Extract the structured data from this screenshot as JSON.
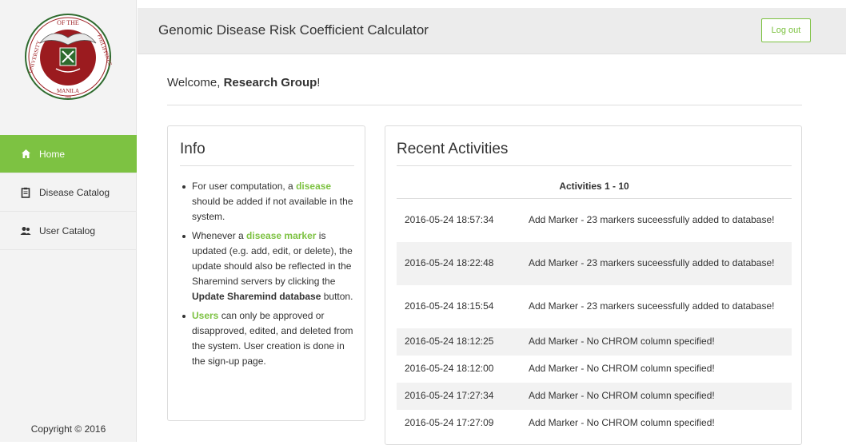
{
  "brand": {
    "logo_label": "University of the Philippines Manila seal",
    "seal_text_top": "OF THE",
    "seal_text_left": "UNIVERSITY",
    "seal_text_right": "PHILIPPINES",
    "seal_text_bottom": "MANILA",
    "seal_year": "1908"
  },
  "sidebar": {
    "items": [
      {
        "label": "Home",
        "icon": "home-icon",
        "active": true
      },
      {
        "label": "Disease Catalog",
        "icon": "clipboard-icon",
        "active": false
      },
      {
        "label": "User Catalog",
        "icon": "users-icon",
        "active": false
      }
    ],
    "copyright": "Copyright © 2016"
  },
  "header": {
    "title": "Genomic Disease Risk Coefficient Calculator",
    "logout_label": "Log out"
  },
  "welcome": {
    "prefix": "Welcome, ",
    "name": "Research Group",
    "suffix": "!"
  },
  "info": {
    "title": "Info",
    "bullet1": {
      "a": "For user computation, a ",
      "link": "disease",
      "b": " should be added if not available in the system."
    },
    "bullet2": {
      "a": "Whenever a ",
      "link": "disease marker",
      "b": " is updated (e.g. add, edit, or delete), the update should also be reflected in the Sharemind servers by clicking the ",
      "bold": "Update Sharemind database",
      "c": " button."
    },
    "bullet3": {
      "link": "Users",
      "b": " can only be approved or disapproved, edited, and deleted from the system. User creation is done in the sign-up page."
    }
  },
  "recent": {
    "title": "Recent Activities",
    "subtitle": "Activities 1 - 10",
    "rows": [
      {
        "time": "2016-05-24 18:57:34",
        "activity": "Add Marker - 23 markers suceessfully added to database!"
      },
      {
        "time": "2016-05-24 18:22:48",
        "activity": "Add Marker - 23 markers suceessfully added to database!"
      },
      {
        "time": "2016-05-24 18:15:54",
        "activity": "Add Marker - 23 markers suceessfully added to database!"
      },
      {
        "time": "2016-05-24 18:12:25",
        "activity": "Add Marker - No CHROM column specified!"
      },
      {
        "time": "2016-05-24 18:12:00",
        "activity": "Add Marker - No CHROM column specified!"
      },
      {
        "time": "2016-05-24 17:27:34",
        "activity": "Add Marker - No CHROM column specified!"
      },
      {
        "time": "2016-05-24 17:27:09",
        "activity": "Add Marker - No CHROM column specified!"
      }
    ]
  },
  "colors": {
    "accent": "#7dc242",
    "seal_red": "#9b1b1f",
    "seal_green": "#2e6b2e"
  }
}
